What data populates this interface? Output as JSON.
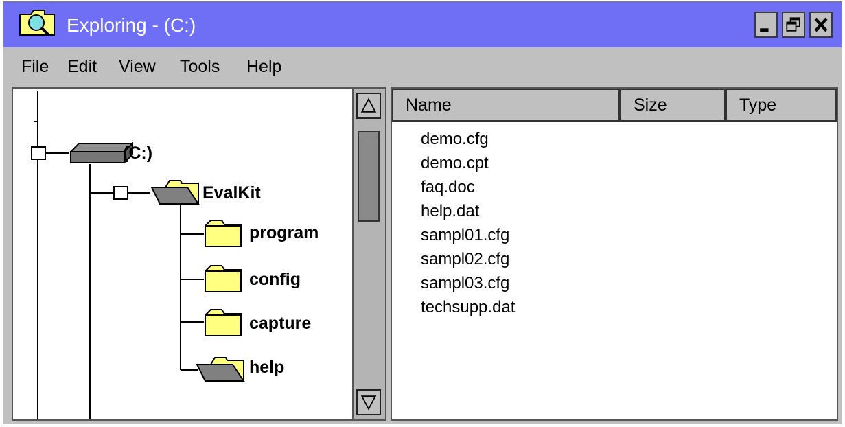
{
  "window": {
    "title": "Exploring - (C:)",
    "controls": {
      "minimize": "minimize",
      "restore": "restore",
      "close": "close"
    }
  },
  "menu": [
    "File",
    "Edit",
    "View",
    "Tools",
    "Help"
  ],
  "tree": {
    "drive": "(C:)",
    "folder": "EvalKit",
    "subfolders": [
      "program",
      "config",
      "capture",
      "help"
    ]
  },
  "list": {
    "columns": [
      "Name",
      "Size",
      "Type"
    ],
    "files": [
      "demo.cfg",
      "demo.cpt",
      "faq.doc",
      "help.dat",
      "sampl01.cfg",
      "sampl02.cfg",
      "sampl03.cfg",
      "techsupp.dat"
    ]
  },
  "colors": {
    "titlebar": "#6f6ff5",
    "chrome": "#c0c0c0",
    "folder": "#ffff80",
    "open_folder_base": "#808080"
  }
}
